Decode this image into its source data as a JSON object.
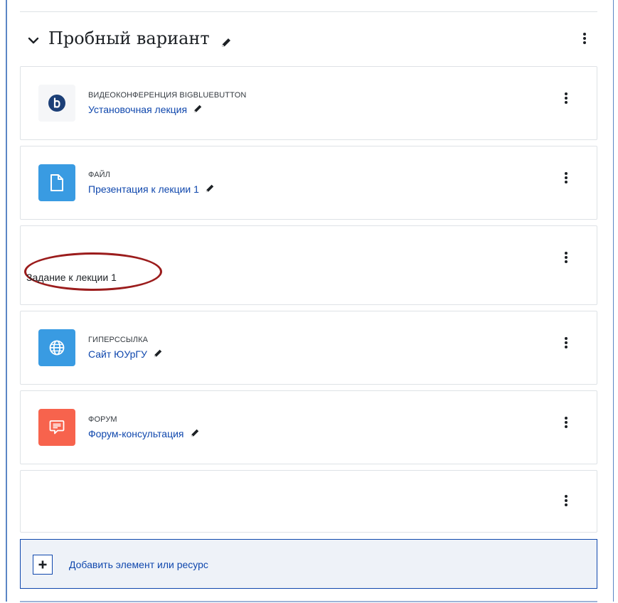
{
  "section": {
    "title": "Пробный вариант",
    "collapse_icon": "chevron-down-icon",
    "edit_icon": "pencil-icon",
    "menu_icon": "kebab-menu-icon"
  },
  "activities": [
    {
      "type": "ВИДЕОКОНФЕРЕНЦИЯ BIGBLUEBUTTON",
      "name": "Установочная лекция",
      "icon": "bigbluebutton-icon",
      "icon_color": "#1c3f77",
      "icon_bg": "#f5f6f8"
    },
    {
      "type": "ФАЙЛ",
      "name": "Презентация к лекции 1",
      "icon": "file-icon",
      "icon_color": "#ffffff",
      "icon_bg": "#399be2"
    },
    {
      "label_text": "Задание к лекции 1",
      "annotation": "red-ellipse-highlight"
    },
    {
      "type": "ГИПЕРССЫЛКА",
      "name": "Сайт ЮУрГУ",
      "icon": "globe-icon",
      "icon_color": "#ffffff",
      "icon_bg": "#399be2"
    },
    {
      "type": "ФОРУМ",
      "name": "Форум-консультация",
      "icon": "forum-icon",
      "icon_color": "#ffffff",
      "icon_bg": "#f7634d"
    },
    {
      "empty": true
    }
  ],
  "add_activity": {
    "label": "Добавить элемент или ресурс",
    "icon": "plus-icon"
  },
  "colors": {
    "link": "#0f47ad",
    "border": "#dee2e6",
    "frame": "#5b86c5",
    "highlight": "#9b1c1c"
  }
}
